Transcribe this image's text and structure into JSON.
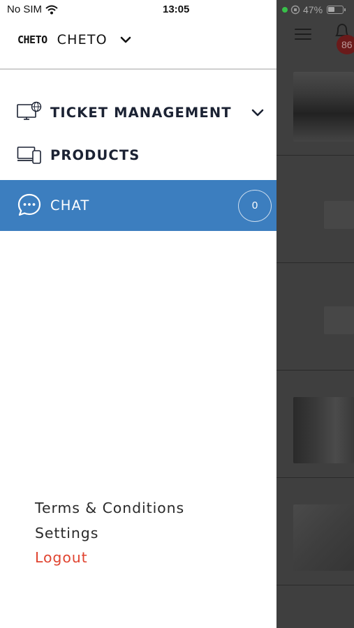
{
  "status_bar": {
    "carrier": "No SIM",
    "time": "13:05",
    "battery": "47%"
  },
  "brand": {
    "logo_text": "CHETO",
    "company_name": "CHETO"
  },
  "nav": {
    "ticket_management": "TICKET MANAGEMENT",
    "products": "PRODUCTS",
    "chat": "CHAT",
    "chat_count": "0"
  },
  "footer": {
    "terms": "Terms & Conditions",
    "settings": "Settings",
    "logout": "Logout"
  },
  "background": {
    "notification_count": "86"
  },
  "colors": {
    "active_item": "#3c7ebf",
    "logout": "#e04430",
    "overlay": "#3f3f3f"
  }
}
